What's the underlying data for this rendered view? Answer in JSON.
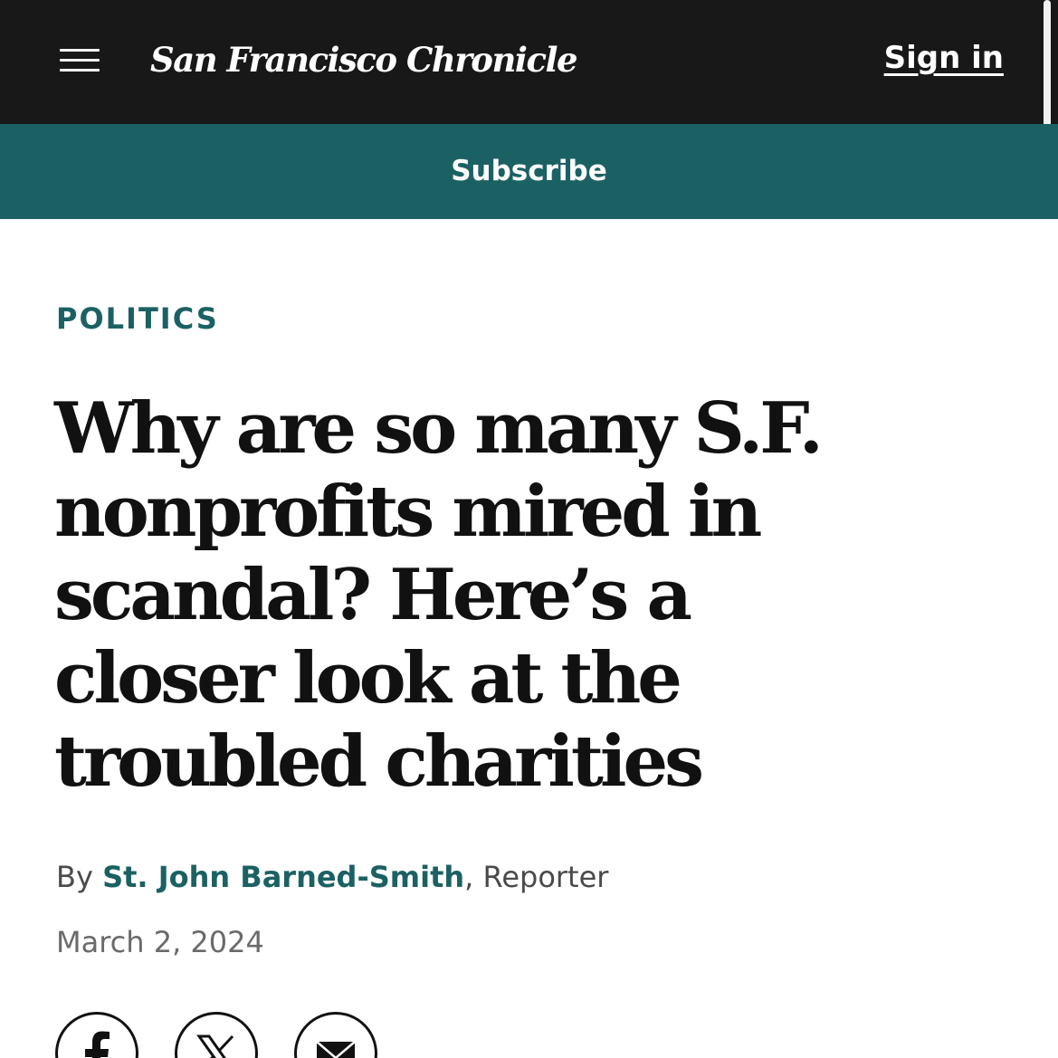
{
  "header": {
    "brand": "San Francisco Chronicle",
    "sign_in": "Sign in",
    "menu_icon": "hamburger-menu-icon"
  },
  "subscribe": {
    "label": "Subscribe"
  },
  "article": {
    "section": "POLITICS",
    "headline": "Why are so many S.F. nonprofits mired in scandal? Here’s a closer look at the troubled charities",
    "byline": {
      "prefix": "By",
      "author": "St. John Barned-Smith",
      "separator": ",",
      "role": "Reporter"
    },
    "date": "March 2, 2024"
  },
  "share": {
    "icons": [
      "facebook-icon",
      "x-icon",
      "email-icon"
    ]
  },
  "colors": {
    "header_bg": "#181818",
    "accent": "#1b6163",
    "text": "#111111",
    "muted": "#6a6a6a"
  }
}
